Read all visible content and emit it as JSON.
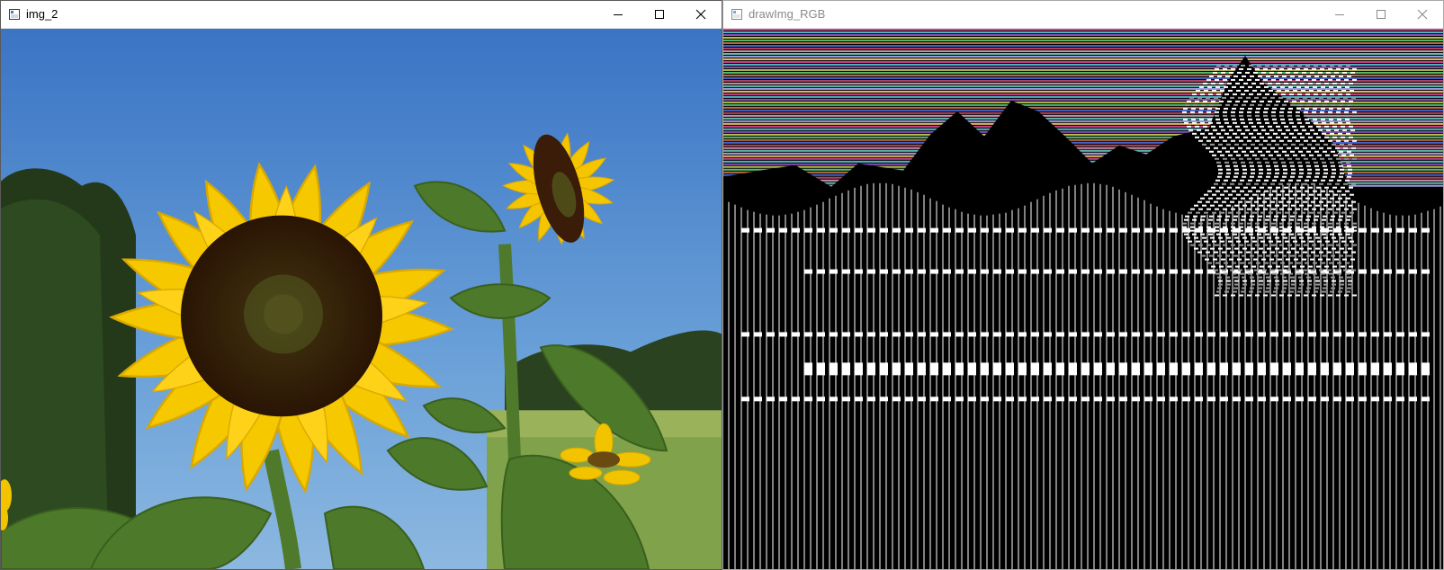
{
  "windows": {
    "left": {
      "title": "img_2",
      "active": true,
      "image_description": "sunflower-photo"
    },
    "right": {
      "title": "drawImg_RGB",
      "active": false,
      "image_description": "striped-rgb-rendering"
    }
  },
  "icons": {
    "app": "window-app-icon",
    "minimize": "minimize-icon",
    "maximize": "maximize-icon",
    "close": "close-icon"
  },
  "colors": {
    "sky": "#4a86c8",
    "petal": "#f2c400",
    "seed": "#3a1c08",
    "leaf": "#4d7a2a",
    "foliage": "#2f4a1f",
    "field": "#7fa24a",
    "stripe_background": "#000000",
    "stripe_line": "#ffffff"
  }
}
